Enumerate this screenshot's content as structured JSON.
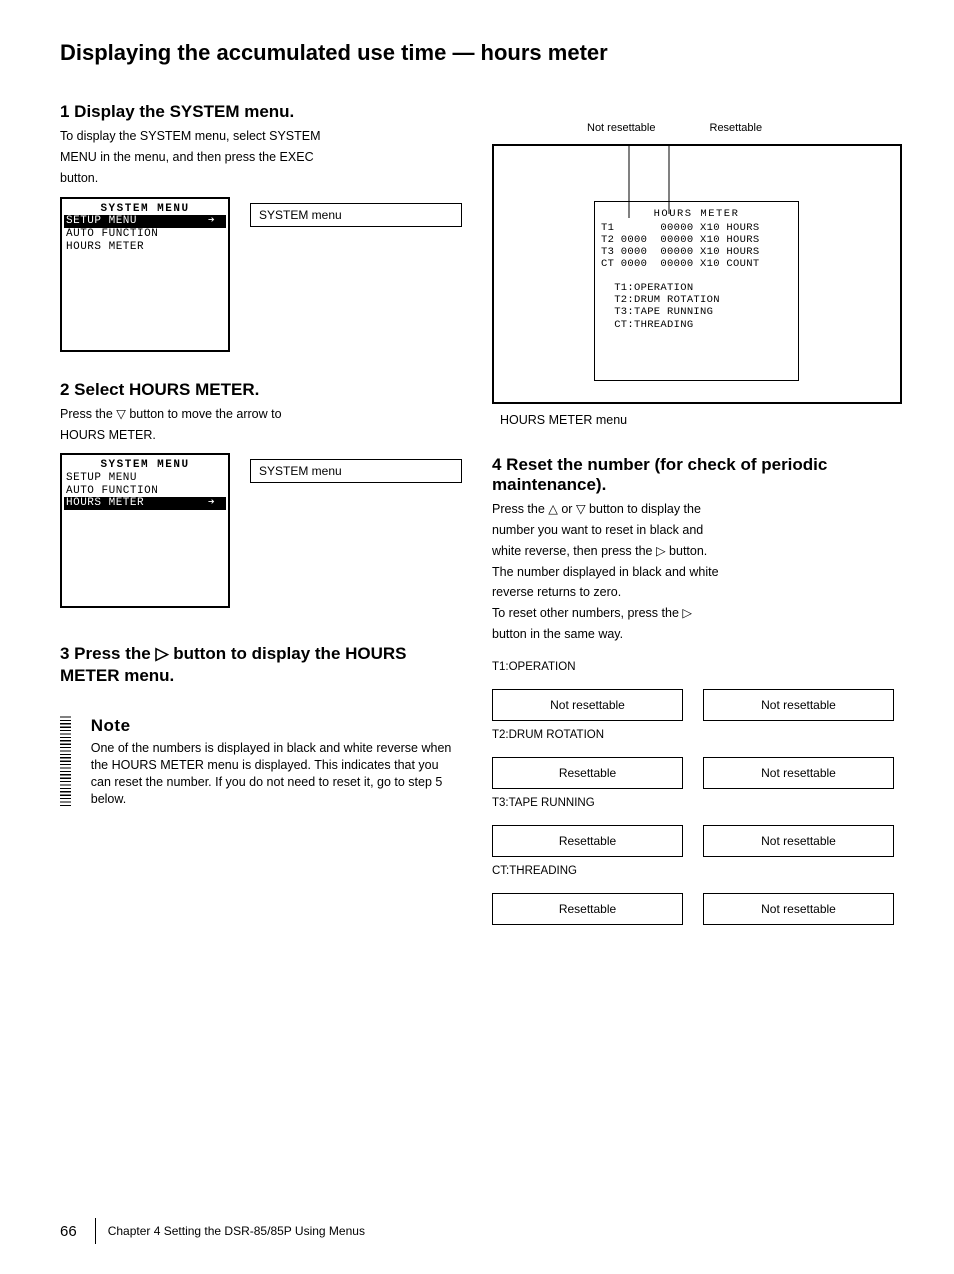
{
  "title": "Displaying the accumulated use time — hours meter",
  "intro_lines": [
    "To display the SYSTEM menu, select SYSTEM",
    "MENU in the menu, and then press the EXEC",
    "button."
  ],
  "lcd1": {
    "title": "SYSTEM MENU",
    "rows": [
      {
        "text": "SETUP MENU          ➔",
        "inv": true
      },
      {
        "text": "AUTO FUNCTION",
        "inv": false
      },
      {
        "text": "HOURS METER",
        "inv": false
      }
    ],
    "callout": "SYSTEM menu"
  },
  "step2": {
    "heading": "2 Select HOURS METER.",
    "lines": [
      "Press the ▽ button to move the arrow to",
      "HOURS METER."
    ]
  },
  "lcd2": {
    "title": "SYSTEM MENU",
    "rows": [
      {
        "text": "SETUP MENU",
        "inv": false
      },
      {
        "text": "AUTO FUNCTION",
        "inv": false
      },
      {
        "text": "HOURS METER         ➔",
        "inv": true
      }
    ],
    "callout": "SYSTEM menu"
  },
  "step3_lines": [
    "3 Press the ▷ button to display the HOURS",
    "   METER menu."
  ],
  "note": {
    "label": "Note",
    "text": "One of the numbers is displayed in black and white reverse when the HOURS METER menu is displayed. This indicates that you can reset the number. If you do not need to reset it, go to step 5 below."
  },
  "display": {
    "top_left_label": "Not resettable",
    "top_right_label": "Resettable",
    "inner": {
      "title": "HOURS METER",
      "lines": [
        "T1       00000 X10 HOURS",
        "T2 0000  00000 X10 HOURS",
        "T3 0000  00000 X10 HOURS",
        "CT 0000  00000 X10 COUNT",
        "",
        "  T1:OPERATION",
        "  T2:DRUM ROTATION",
        "  T3:TAPE RUNNING",
        "  CT:THREADING"
      ]
    },
    "under_label": "HOURS METER menu"
  },
  "step4": {
    "heading": "4 Reset the number (for check of periodic maintenance).",
    "lines": [
      "Press the △ or ▽ button to display the",
      "number you want to reset in black and",
      "white reverse, then press the ▷ button.",
      "The number displayed in black and white",
      "reverse returns to zero.",
      "To reset other numbers, press the ▷",
      "button in the same way."
    ]
  },
  "buttons": {
    "t1_label": "T1:OPERATION",
    "t1_l": "Not resettable",
    "t1_r": "Not resettable",
    "t2_label": "T2:DRUM ROTATION",
    "t2_l": "Resettable",
    "t2_r": "Not resettable",
    "t3_label": "T3:TAPE RUNNING",
    "t3_l": "Resettable",
    "t3_r": "Not resettable",
    "ct_label": "CT:THREADING",
    "ct_l": "Resettable",
    "ct_r": "Not resettable"
  },
  "footer": {
    "page": "66",
    "chapter": "Chapter 4 Setting the DSR-85/85P Using Menus"
  }
}
